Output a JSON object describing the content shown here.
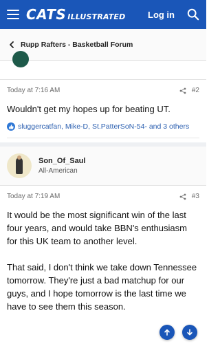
{
  "header": {
    "logo_main": "CATS",
    "logo_sub": "ILLUSTRATED",
    "login_label": "Log in",
    "brand_color": "#1a56b8"
  },
  "breadcrumb": {
    "label": "Rupp Rafters - Basketball Forum"
  },
  "posts": [
    {
      "timestamp": "Today at 7:16 AM",
      "number": "#2",
      "body": "Wouldn't get my hopes up for beating UT.",
      "reactions": "sluggercatfan, Mike-D, St.PatterSoN-54- and 3 others"
    },
    {
      "author": "Son_Of_Saul",
      "rank": "All-American",
      "timestamp": "Today at 7:19 AM",
      "number": "#3",
      "paragraphs": [
        "It would be the most significant win of the last four years, and would take BBN's enthusiasm for this UK team to another level.",
        "That said, I don't think we take down Tennessee tomorrow. They're just a bad matchup for our guys, and I hope tomorrow is the last time we have to see them this season."
      ]
    }
  ]
}
